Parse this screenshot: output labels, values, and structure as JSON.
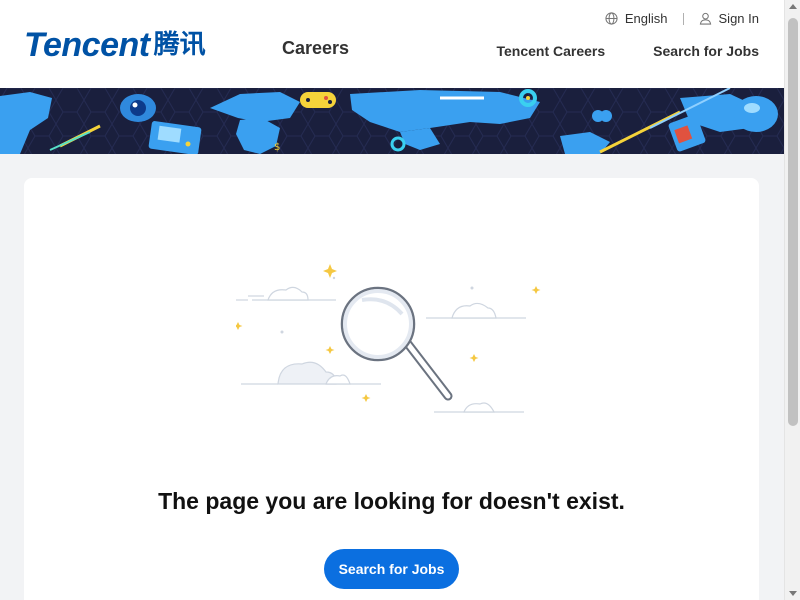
{
  "header": {
    "logo_text": "Tencent",
    "logo_cn": "腾讯",
    "section_title": "Careers",
    "language_label": "English",
    "signin_label": "Sign In",
    "nav": [
      {
        "label": "Tencent Careers"
      },
      {
        "label": "Search for Jobs"
      }
    ],
    "icons": {
      "language": "globe-icon",
      "signin": "user-icon"
    }
  },
  "banner": {
    "description_icons": [
      "world-map",
      "game-controller",
      "handheld-console",
      "eye",
      "bubble",
      "sim-card"
    ]
  },
  "main": {
    "message": "The page you are looking for doesn't exist.",
    "cta_label": "Search for Jobs",
    "illustration_icon": "magnifier-icon"
  },
  "colors": {
    "brand_blue": "#0052a5",
    "cta_blue": "#0b6fe0",
    "banner_bg": "#1a1f3d",
    "map_blue": "#3aa0f0",
    "page_bg": "#f2f3f5"
  }
}
